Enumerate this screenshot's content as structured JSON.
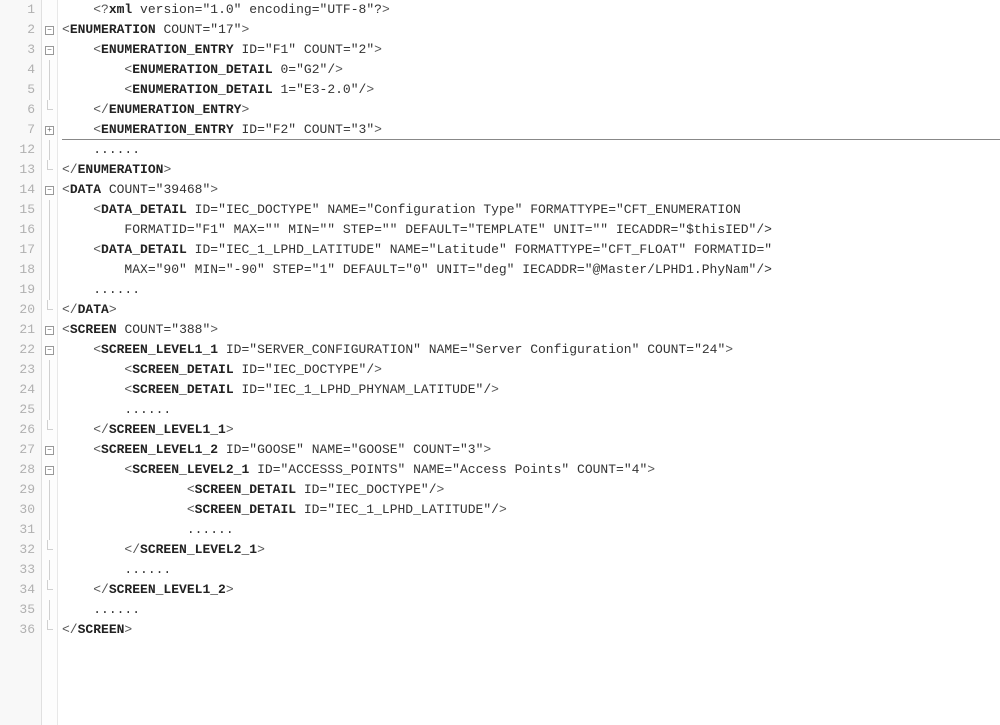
{
  "lines": [
    {
      "num": "1",
      "fold": "",
      "indent": "    ",
      "text": "<?xml version=\"1.0\" encoding=\"UTF-8\"?>",
      "sep": false
    },
    {
      "num": "2",
      "fold": "minus",
      "indent": "",
      "text": "<ENUMERATION COUNT=\"17\">",
      "sep": false
    },
    {
      "num": "3",
      "fold": "minus",
      "indent": "    ",
      "text": "<ENUMERATION_ENTRY ID=\"F1\" COUNT=\"2\">",
      "sep": false
    },
    {
      "num": "4",
      "fold": "line",
      "indent": "        ",
      "text": "<ENUMERATION_DETAIL 0=\"G2\"/>",
      "sep": false
    },
    {
      "num": "5",
      "fold": "line",
      "indent": "        ",
      "text": "<ENUMERATION_DETAIL 1=\"E3-2.0\"/>",
      "sep": false
    },
    {
      "num": "6",
      "fold": "end",
      "indent": "    ",
      "text": "</ENUMERATION_ENTRY>",
      "sep": false
    },
    {
      "num": "7",
      "fold": "plus",
      "indent": "    ",
      "text": "<ENUMERATION_ENTRY ID=\"F2\" COUNT=\"3\">",
      "sep": true
    },
    {
      "num": "12",
      "fold": "line",
      "indent": "    ",
      "text": "......",
      "sep": false
    },
    {
      "num": "13",
      "fold": "end",
      "indent": "",
      "text": "</ENUMERATION>",
      "sep": false
    },
    {
      "num": "14",
      "fold": "minus",
      "indent": "",
      "text": "<DATA COUNT=\"39468\">",
      "sep": false
    },
    {
      "num": "15",
      "fold": "line",
      "indent": "    ",
      "text": "<DATA_DETAIL ID=\"IEC_DOCTYPE\" NAME=\"Configuration Type\" FORMATTYPE=\"CFT_ENUMERATION\"",
      "sep": false
    },
    {
      "num": "16",
      "fold": "line",
      "indent": "        ",
      "text": "FORMATID=\"F1\" MAX=\"\" MIN=\"\" STEP=\"\" DEFAULT=\"TEMPLATE\" UNIT=\"\" IECADDR=\"$thisIED\"/>",
      "sep": false
    },
    {
      "num": "17",
      "fold": "line",
      "indent": "    ",
      "text": "<DATA_DETAIL ID=\"IEC_1_LPHD_LATITUDE\" NAME=\"Latitude\" FORMATTYPE=\"CFT_FLOAT\" FORMATID=\"\"",
      "sep": false
    },
    {
      "num": "18",
      "fold": "line",
      "indent": "        ",
      "text": "MAX=\"90\" MIN=\"-90\" STEP=\"1\" DEFAULT=\"0\" UNIT=\"deg\" IECADDR=\"@Master/LPHD1.PhyNam\"/>",
      "sep": false
    },
    {
      "num": "19",
      "fold": "line",
      "indent": "    ",
      "text": "......",
      "sep": false
    },
    {
      "num": "20",
      "fold": "end",
      "indent": "",
      "text": "</DATA>",
      "sep": false
    },
    {
      "num": "21",
      "fold": "minus",
      "indent": "",
      "text": "<SCREEN COUNT=\"388\">",
      "sep": false
    },
    {
      "num": "22",
      "fold": "minus",
      "indent": "    ",
      "text": "<SCREEN_LEVEL1_1 ID=\"SERVER_CONFIGURATION\" NAME=\"Server Configuration\" COUNT=\"24\">",
      "sep": false
    },
    {
      "num": "23",
      "fold": "line",
      "indent": "        ",
      "text": "<SCREEN_DETAIL ID=\"IEC_DOCTYPE\"/>",
      "sep": false
    },
    {
      "num": "24",
      "fold": "line",
      "indent": "        ",
      "text": "<SCREEN_DETAIL ID=\"IEC_1_LPHD_PHYNAM_LATITUDE\"/>",
      "sep": false
    },
    {
      "num": "25",
      "fold": "line",
      "indent": "        ",
      "text": "......",
      "sep": false
    },
    {
      "num": "26",
      "fold": "end",
      "indent": "    ",
      "text": "</SCREEN_LEVEL1_1>",
      "sep": false
    },
    {
      "num": "27",
      "fold": "minus",
      "indent": "    ",
      "text": "<SCREEN_LEVEL1_2 ID=\"GOOSE\" NAME=\"GOOSE\" COUNT=\"3\">",
      "sep": false
    },
    {
      "num": "28",
      "fold": "minus",
      "indent": "        ",
      "text": "<SCREEN_LEVEL2_1 ID=\"ACCESSS_POINTS\" NAME=\"Access Points\" COUNT=\"4\">",
      "sep": false
    },
    {
      "num": "29",
      "fold": "line",
      "indent": "                ",
      "text": "<SCREEN_DETAIL ID=\"IEC_DOCTYPE\"/>",
      "sep": false
    },
    {
      "num": "30",
      "fold": "line",
      "indent": "                ",
      "text": "<SCREEN_DETAIL ID=\"IEC_1_LPHD_LATITUDE\"/>",
      "sep": false
    },
    {
      "num": "31",
      "fold": "line",
      "indent": "                ",
      "text": "......",
      "sep": false
    },
    {
      "num": "32",
      "fold": "end",
      "indent": "        ",
      "text": "</SCREEN_LEVEL2_1>",
      "sep": false
    },
    {
      "num": "33",
      "fold": "line",
      "indent": "        ",
      "text": "......",
      "sep": false
    },
    {
      "num": "34",
      "fold": "end",
      "indent": "    ",
      "text": "</SCREEN_LEVEL1_2>",
      "sep": false
    },
    {
      "num": "35",
      "fold": "line",
      "indent": "    ",
      "text": "......",
      "sep": false
    },
    {
      "num": "36",
      "fold": "end",
      "indent": "",
      "text": "</SCREEN>",
      "sep": false
    }
  ]
}
